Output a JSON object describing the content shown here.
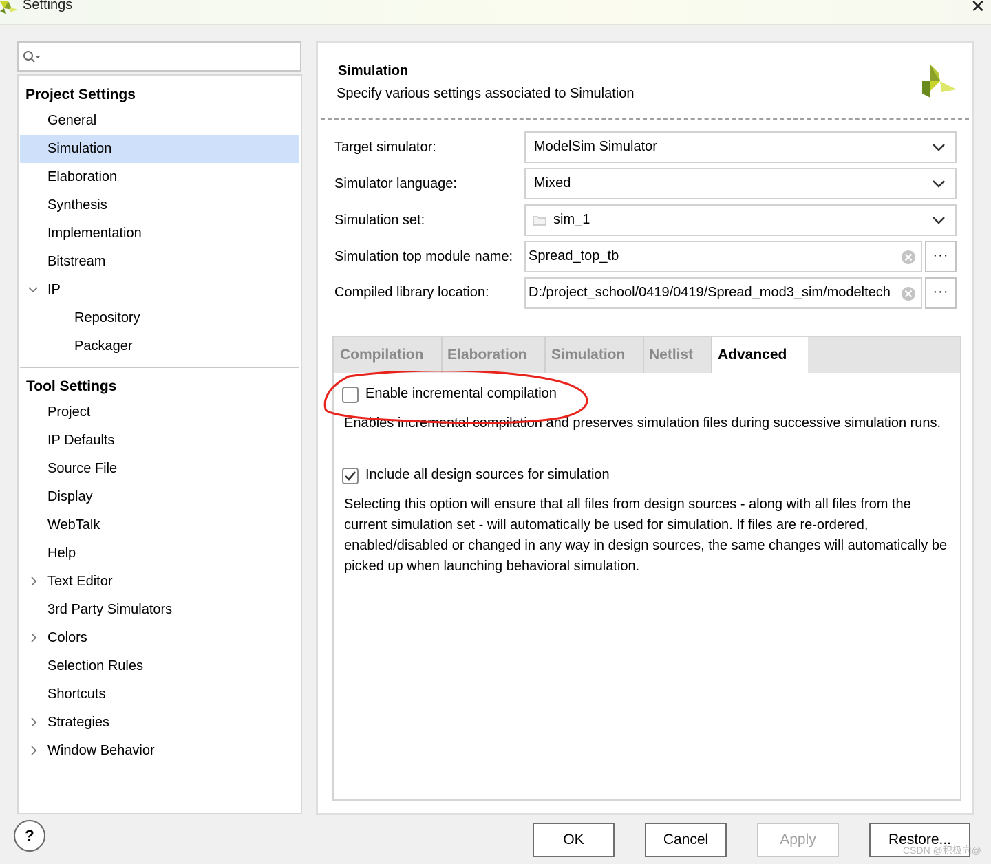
{
  "window": {
    "title": "Settings",
    "close_glyph": "✕"
  },
  "search": {
    "value": "",
    "placeholder": ""
  },
  "sidebar": {
    "project_settings_title": "Project Settings",
    "project_items": [
      {
        "label": "General"
      },
      {
        "label": "Simulation"
      },
      {
        "label": "Elaboration"
      },
      {
        "label": "Synthesis"
      },
      {
        "label": "Implementation"
      },
      {
        "label": "Bitstream"
      },
      {
        "label": "IP"
      },
      {
        "label": "Repository"
      },
      {
        "label": "Packager"
      }
    ],
    "selected": "Simulation",
    "tool_settings_title": "Tool Settings",
    "tool_items": [
      {
        "label": "Project"
      },
      {
        "label": "IP Defaults"
      },
      {
        "label": "Source File"
      },
      {
        "label": "Display"
      },
      {
        "label": "WebTalk"
      },
      {
        "label": "Help"
      },
      {
        "label": "Text Editor"
      },
      {
        "label": "3rd Party Simulators"
      },
      {
        "label": "Colors"
      },
      {
        "label": "Selection Rules"
      },
      {
        "label": "Shortcuts"
      },
      {
        "label": "Strategies"
      },
      {
        "label": "Window Behavior"
      }
    ]
  },
  "main": {
    "title": "Simulation",
    "description": "Specify various settings associated to Simulation",
    "fields": {
      "target_simulator": {
        "label": "Target simulator:",
        "value": "ModelSim Simulator"
      },
      "simulator_language": {
        "label": "Simulator language:",
        "value": "Mixed"
      },
      "simulation_set": {
        "label": "Simulation set:",
        "value": "sim_1"
      },
      "top_module": {
        "label": "Simulation top module name:",
        "value": "Spread_top_tb"
      },
      "compiled_library": {
        "label": "Compiled library location:",
        "value": "D:/project_school/0419/0419/Spread_mod3_sim/modeltech"
      }
    },
    "browse_label": "···",
    "tabs": [
      {
        "label": "Compilation"
      },
      {
        "label": "Elaboration"
      },
      {
        "label": "Simulation"
      },
      {
        "label": "Netlist"
      },
      {
        "label": "Advanced"
      }
    ],
    "active_tab": "Advanced",
    "advanced": {
      "incremental": {
        "label": "Enable incremental compilation",
        "checked": false,
        "description": "Enables incremental compilation and preserves simulation files during successive simulation runs."
      },
      "include_all": {
        "label": "Include all design sources for simulation",
        "checked": true,
        "description": "Selecting this option will ensure that all files from design sources - along with all files from the current simulation set - will automatically be used for simulation. If files are re-ordered, enabled/disabled or changed in any way in design sources, the same changes will automatically be picked up when launching behavioral simulation."
      }
    },
    "annotation_color": "#e8231c"
  },
  "footer": {
    "help": "?",
    "ok": "OK",
    "cancel": "Cancel",
    "apply": "Apply",
    "restore": "Restore..."
  },
  "watermark": "CSDN @积极向@",
  "colors": {
    "selection": "#cfe0fb",
    "logo_yellow": "#c8d42a",
    "logo_green": "#6a8a1e"
  }
}
